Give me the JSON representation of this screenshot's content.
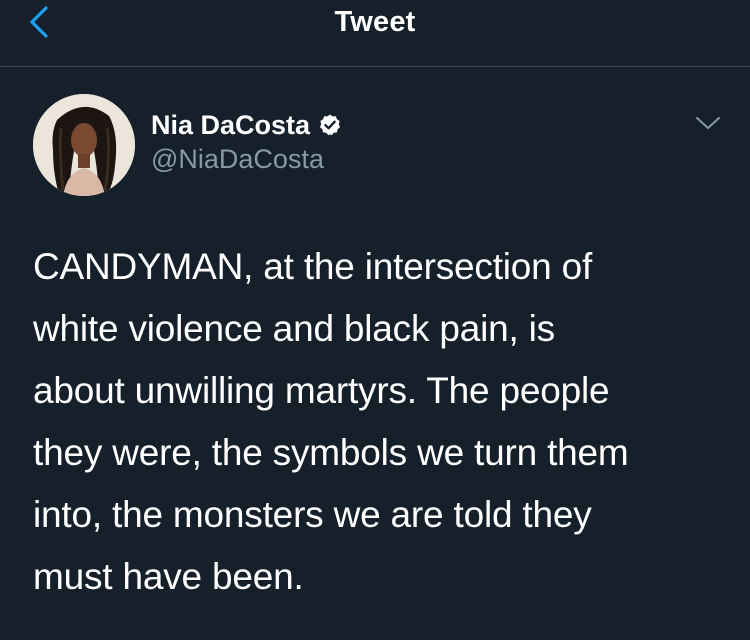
{
  "nav": {
    "title": "Tweet",
    "back_icon": "chevron-left-icon"
  },
  "colors": {
    "background": "#15202b",
    "accent": "#1da1f2",
    "secondary_text": "#8899a6",
    "divider": "#38444d"
  },
  "tweet": {
    "author": {
      "display_name": "Nia DaCosta",
      "handle": "@NiaDaCosta",
      "verified_icon": "verified-badge-icon",
      "avatar_icon": "profile-photo"
    },
    "menu_icon": "chevron-down-icon",
    "text": "CANDYMAN, at the intersection of\nwhite violence and black pain, is\nabout unwilling martyrs. The people\nthey were, the symbols we turn them\ninto, the monsters we are told they\nmust have been."
  }
}
